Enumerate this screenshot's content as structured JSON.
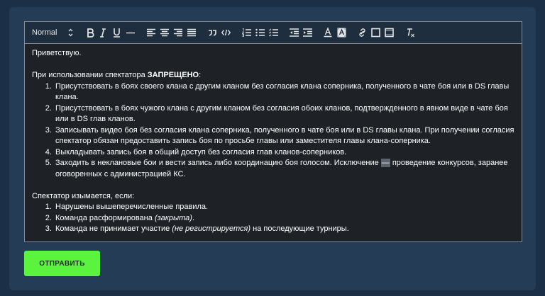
{
  "toolbar": {
    "format_value": "Normal",
    "format_caret": "⌃⌄",
    "quote_glyph": "99",
    "code_glyph": "</>",
    "clean_glyph": "Tx"
  },
  "content": {
    "greeting": "Приветствую.",
    "rule_intro_prefix": "При использовании спектатора ",
    "rule_intro_bold": "ЗАПРЕЩЕНО",
    "rule_intro_suffix": ":",
    "rules": [
      "Присутствовать в боях своего клана с другим кланом без согласия клана соперника, полученного в чате боя или в DS главы клана.",
      "Присутствовать в боях чужого клана с другим кланом без согласия обоих кланов, подтвержденного в явном виде в чате боя или в DS глав кланов.",
      "Записывать видео боя без согласия клана соперника, полученного в чате боя или в DS главы клана. При получении согласия спектатор обязан предоставить запись боя по просьбе главы или заместителя главы клана-соперника.",
      "Выкладывать запись боя в общий доступ без согласия глав кланов-соперников."
    ],
    "rule5_prefix": "Заходить в неклановые бои и вести запись либо координацию боя голосом. Исключение ",
    "rule5_dash": "—",
    "rule5_suffix": " проведение конкурсов, заранее оговоренных с администрацией КС.",
    "seizure_intro": "Спектатор изымается, если:",
    "seizure_1": "Нарушены вышеперечисленные правила.",
    "seizure_2_prefix": "Команда расформирована ",
    "seizure_2_italic": "(закрыта)",
    "seizure_2_suffix": ".",
    "seizure_3_prefix": "Команда не принимает участие ",
    "seizure_3_italic": "(не регистрируется)",
    "seizure_3_suffix": " на последующие турниры."
  },
  "submit_label": "ОТПРАВИТЬ"
}
